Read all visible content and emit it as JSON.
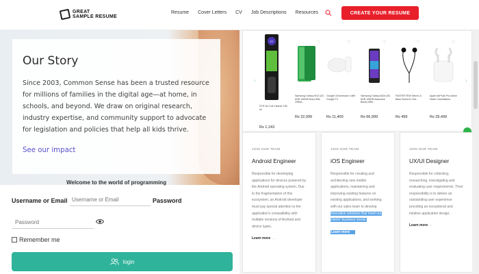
{
  "header": {
    "logo_line1": "GREAT",
    "logo_line2": "SAMPLE RESUME",
    "nav": [
      "Resume",
      "Cover Letters",
      "CV",
      "Job Descriptions",
      "Resources"
    ],
    "cta": "CREATE YOUR RESUME",
    "accent": "#e8202b"
  },
  "story": {
    "title": "Our Story",
    "body": "Since 2003, Common Sense has been a trusted resource for millions of families in the digital age—at home, in schools, and beyond. We draw on original research, industry expertise, and community support to advocate for legislation and policies that help all kids thrive.",
    "link": "See our impact"
  },
  "login": {
    "welcome": "Welcome to the world of programming",
    "username_label": "Username or Email",
    "username_placeholder": "Username or Email",
    "password_label": "Password",
    "password_placeholder": "Password",
    "remember": "Remember me",
    "button": "login",
    "button_color": "#30b39b"
  },
  "products": {
    "arrow_left": "‹",
    "arrow_right": "›",
    "items": [
      {
        "name": "STIF Air Coil Cleaner 150 ml",
        "price": "Rs 1,143",
        "icon": "spray-can"
      },
      {
        "name": "Samsung Galaxy M12 (4G 6GB 128GB Blue) With Offical...",
        "price": "Rs 22,099",
        "icon": "phone-green"
      },
      {
        "name": "Google Chromecast 4 with Google TV",
        "price": "Rs 11,400",
        "icon": "chromecast"
      },
      {
        "name": "Samsung Galaxy A52s (5G 6GB 128GB Awesome Black) With...",
        "price": "Rs 66,999",
        "icon": "phone-black"
      },
      {
        "name": "FASTER FEW Stereo & Bass Sound In-Ear...",
        "price": "Rs 499",
        "icon": "earphones"
      },
      {
        "name": "Apple AirPods Pro Active Noise Cancellation",
        "price": "Rs 29,499",
        "icon": "airpods"
      }
    ]
  },
  "jobs": [
    {
      "kicker": "JOIN OUR TEAM",
      "title": "Android Engineer",
      "desc": "Responsible for developing applications for devices powered by the Android operating system. Due to the fragmentation of this ecosystem, an Android developer must pay special attention to the application's compatibility with multiple versions of Android and device types.",
      "desc_hl": "",
      "link": "Learn more"
    },
    {
      "kicker": "JOIN OUR TEAM",
      "title": "iOS Engineer",
      "desc": "Responsible for creating and architecting new mobile applications, maintaining and improving existing features on existing applications, and working with our sales team to develop ",
      "desc_hl": "innovative solutions that meet our clients' business needs.",
      "link": "Learn more"
    },
    {
      "kicker": "JOIN OUR TEAM",
      "title": "UX/UI Designer",
      "desc": "Responsible for collecting, researching, investigating and evaluating user requirements. Their responsibility is to deliver an outstanding user experience providing an exceptional and intuitive application design.",
      "desc_hl": "",
      "link": "Learn more"
    }
  ]
}
